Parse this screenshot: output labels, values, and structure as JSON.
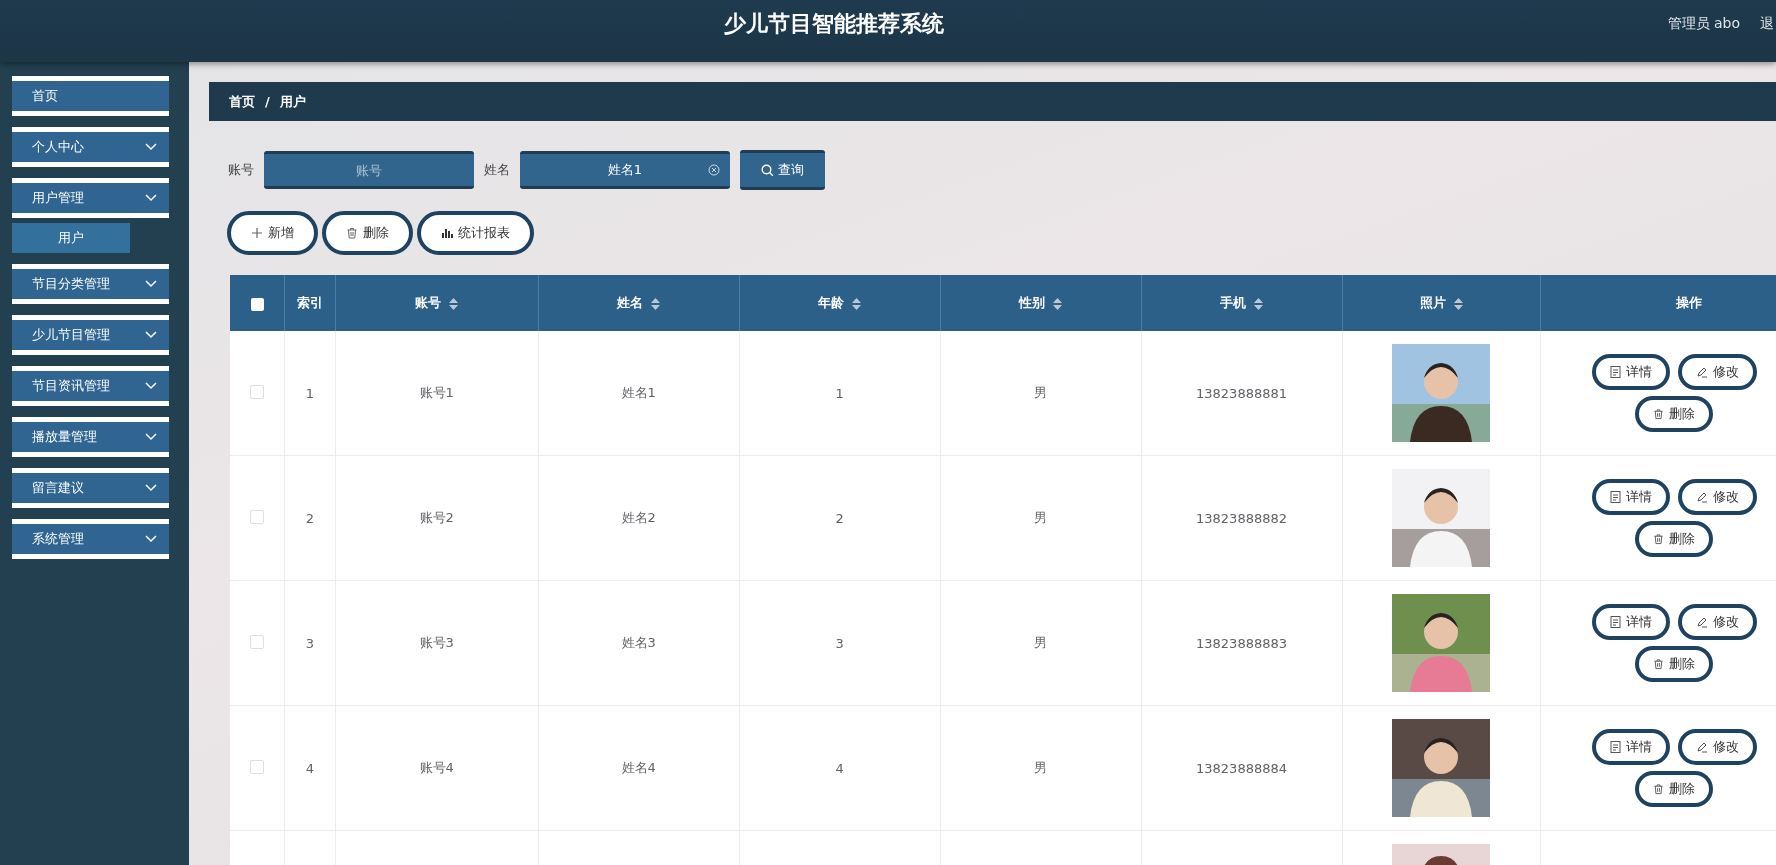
{
  "header": {
    "title": "少儿节目智能推荐系统",
    "user": "管理员 abo",
    "logout": "退"
  },
  "sidebar": {
    "items": [
      {
        "label": "首页",
        "kind": "link"
      },
      {
        "label": "个人中心",
        "kind": "group"
      },
      {
        "label": "用户管理",
        "kind": "group",
        "children": [
          {
            "label": "用户",
            "selected": true
          }
        ]
      },
      {
        "label": "节目分类管理",
        "kind": "group"
      },
      {
        "label": "少儿节目管理",
        "kind": "group"
      },
      {
        "label": "节目资讯管理",
        "kind": "group"
      },
      {
        "label": "播放量管理",
        "kind": "group"
      },
      {
        "label": "留言建议",
        "kind": "group"
      },
      {
        "label": "系统管理",
        "kind": "group"
      }
    ]
  },
  "breadcrumb": {
    "items": [
      "首页",
      "用户"
    ],
    "separator": "/"
  },
  "search": {
    "fields": [
      {
        "label": "账号",
        "placeholder": "账号"
      },
      {
        "label": "姓名",
        "value": "姓名1"
      }
    ],
    "button": "查询"
  },
  "actions": [
    {
      "label": "新增",
      "kind": "add"
    },
    {
      "label": "删除",
      "kind": "delete"
    },
    {
      "label": "统计报表",
      "kind": "chart"
    }
  ],
  "table": {
    "select_all": {
      "checked": false
    },
    "columns": [
      {
        "label": "索引",
        "sortable": false
      },
      {
        "label": "账号",
        "sortable": true
      },
      {
        "label": "姓名",
        "sortable": true
      },
      {
        "label": "年龄",
        "sortable": true
      },
      {
        "label": "性别",
        "sortable": true
      },
      {
        "label": "手机",
        "sortable": true
      },
      {
        "label": "照片",
        "sortable": true
      },
      {
        "label": "操作",
        "sortable": false
      }
    ],
    "rows": [
      {
        "kind": "full",
        "selected": false,
        "index": "1",
        "account": "账号1",
        "name": "姓名1",
        "age": "1",
        "gender": "男",
        "phone": "13823888881",
        "buttons": [
          "详情",
          "修改",
          "删除"
        ]
      },
      {
        "kind": "full",
        "selected": false,
        "index": "2",
        "account": "账号2",
        "name": "姓名2",
        "age": "2",
        "gender": "男",
        "phone": "13823888882",
        "buttons": [
          "详情",
          "修改",
          "删除"
        ]
      },
      {
        "kind": "full",
        "selected": false,
        "index": "3",
        "account": "账号3",
        "name": "姓名3",
        "age": "3",
        "gender": "男",
        "phone": "13823888883",
        "buttons": [
          "详情",
          "修改",
          "删除"
        ]
      },
      {
        "kind": "full",
        "selected": false,
        "index": "4",
        "account": "账号4",
        "name": "姓名4",
        "age": "4",
        "gender": "男",
        "phone": "13823888884",
        "buttons": [
          "详情",
          "修改",
          "删除"
        ]
      },
      {
        "kind": "partial"
      }
    ]
  }
}
